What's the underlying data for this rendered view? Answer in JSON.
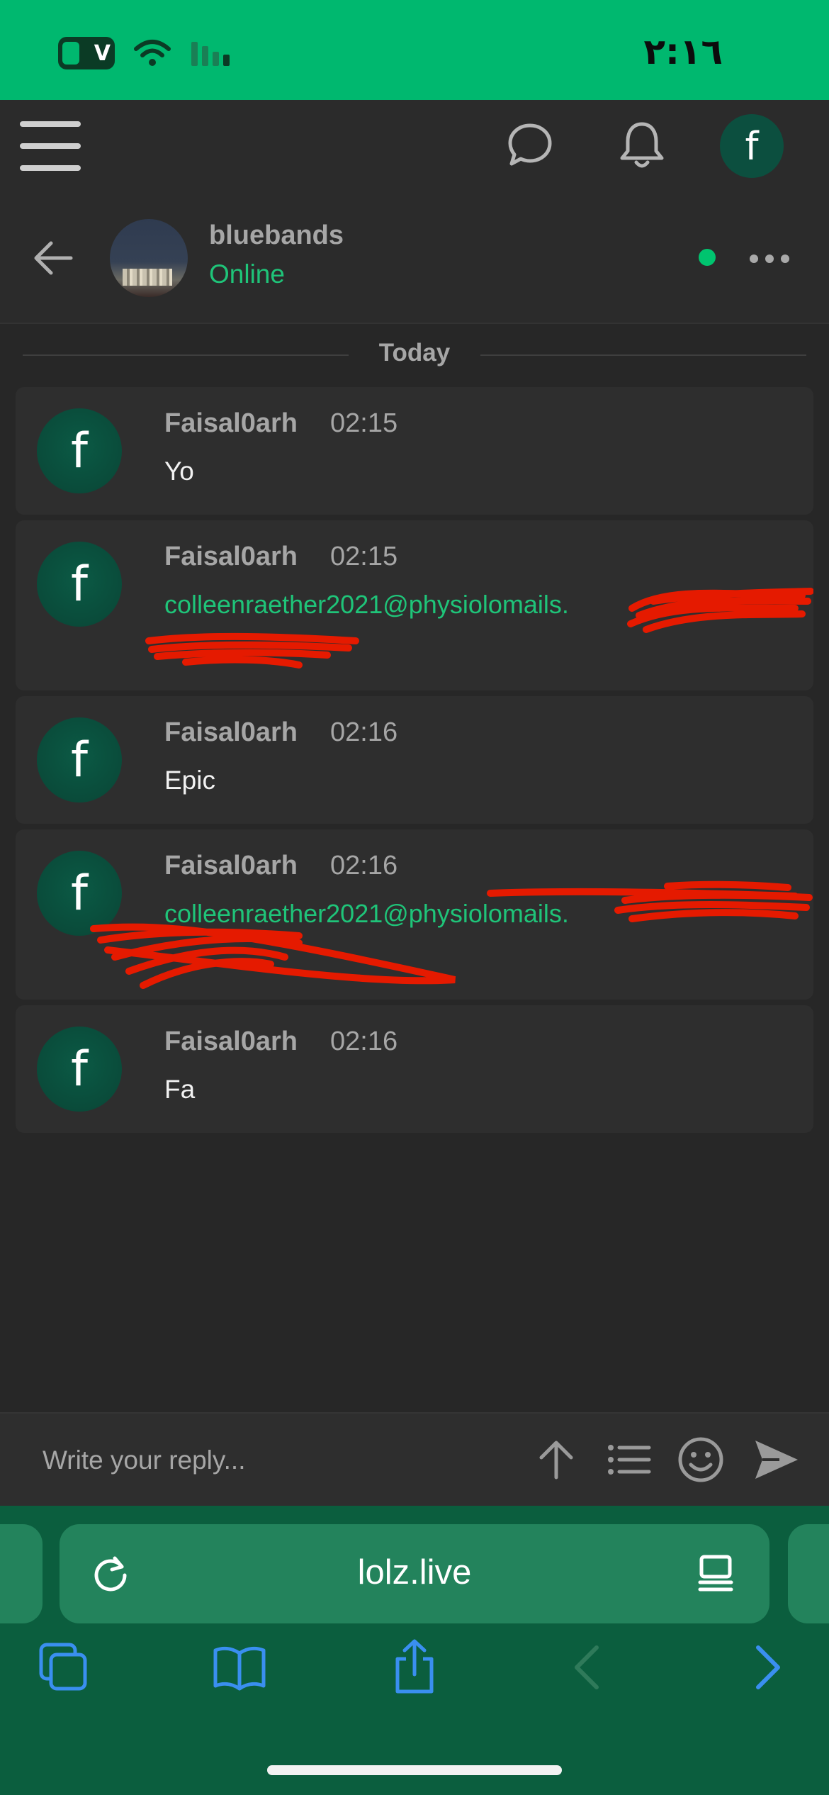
{
  "status_bar": {
    "battery_label": "V",
    "time": "٢:١٦"
  },
  "header": {
    "avatar_initial": "f"
  },
  "conversation": {
    "contact_name": "bluebands",
    "contact_status": "Online",
    "date_divider": "Today"
  },
  "messages": [
    {
      "avatar_initial": "f",
      "author": "Faisal0arh",
      "time": "02:15",
      "text": "Yo",
      "is_link": false
    },
    {
      "avatar_initial": "f",
      "author": "Faisal0arh",
      "time": "02:15",
      "text": "colleenraether2021@physiolomails.",
      "is_link": true
    },
    {
      "avatar_initial": "f",
      "author": "Faisal0arh",
      "time": "02:16",
      "text": "Epic",
      "is_link": false
    },
    {
      "avatar_initial": "f",
      "author": "Faisal0arh",
      "time": "02:16",
      "text": "colleenraether2021@physiolomails.",
      "is_link": true
    },
    {
      "avatar_initial": "f",
      "author": "Faisal0arh",
      "time": "02:16",
      "text": "Fa",
      "is_link": false
    }
  ],
  "reply": {
    "placeholder": "Write your reply..."
  },
  "browser": {
    "url": "lolz.live"
  },
  "colors": {
    "accent_green": "#00b86f",
    "link_green": "#1fc479",
    "background": "#272727",
    "browser_bar": "#0b5e3e",
    "redaction_red": "#e51a00"
  },
  "icons": {
    "header": [
      "menu-icon",
      "chat-bubble-icon",
      "bell-icon"
    ],
    "conversation": [
      "back-arrow-icon",
      "more-dots-icon"
    ],
    "reply": [
      "upload-arrow-icon",
      "list-icon",
      "smiley-icon",
      "send-icon"
    ],
    "browser": [
      "reload-icon",
      "reader-icon",
      "tabs-icon",
      "bookmarks-icon",
      "share-icon",
      "back-chevron-icon",
      "forward-chevron-icon"
    ]
  }
}
